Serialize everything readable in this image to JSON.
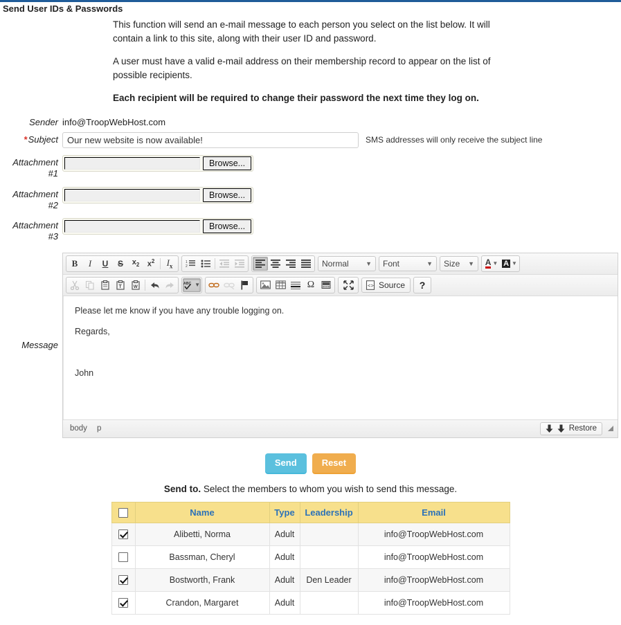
{
  "page": {
    "title": "Send User IDs & Passwords",
    "intro": [
      {
        "text": "This function will send an e-mail message to each person you select on the list below. It will contain a link to this site, along with their user ID and password.",
        "bold": false
      },
      {
        "text": "A user must have a valid e-mail address on their membership record to appear on the list of possible recipients.",
        "bold": false
      },
      {
        "text": "Each recipient will be required to change their password the next time they log on.",
        "bold": true
      }
    ]
  },
  "form": {
    "sender_label": "Sender",
    "sender_value": "info@TroopWebHost.com",
    "subject_label": "Subject",
    "subject_required_marker": "*",
    "subject_value": "Our new website is now available!",
    "subject_placeholder": "",
    "sms_note": "SMS addresses will only receive the subject line",
    "attachments": [
      {
        "label_line1": "Attachment",
        "label_line2": "#1",
        "value": "",
        "browse_label": "Browse..."
      },
      {
        "label_line1": "Attachment",
        "label_line2": "#2",
        "value": "",
        "browse_label": "Browse..."
      },
      {
        "label_line1": "Attachment",
        "label_line2": "#3",
        "value": "",
        "browse_label": "Browse..."
      }
    ],
    "message_label": "Message"
  },
  "editor": {
    "toolbar_row1": {
      "group_basic": [
        {
          "icon": "bold-icon",
          "label": "B"
        },
        {
          "icon": "italic-icon",
          "label": "I"
        },
        {
          "icon": "underline-icon",
          "label": "U"
        },
        {
          "icon": "strikethrough-icon",
          "label": "S"
        },
        {
          "icon": "subscript-icon",
          "label": "x₂"
        },
        {
          "icon": "superscript-icon",
          "label": "x²"
        },
        {
          "icon": "remove-format-icon",
          "label": "Iₓ"
        }
      ],
      "group_lists": [
        {
          "icon": "numbered-list-icon"
        },
        {
          "icon": "bulleted-list-icon"
        },
        {
          "icon": "decrease-indent-icon"
        },
        {
          "icon": "increase-indent-icon"
        }
      ],
      "group_align": [
        {
          "icon": "align-left-icon",
          "active": true
        },
        {
          "icon": "align-center-icon",
          "active": false
        },
        {
          "icon": "align-right-icon",
          "active": false
        },
        {
          "icon": "align-justify-icon",
          "active": false
        }
      ],
      "combo_format": "Normal",
      "combo_font": "Font",
      "combo_size": "Size",
      "group_color": [
        {
          "icon": "text-color-icon",
          "label": "A"
        },
        {
          "icon": "background-color-icon",
          "label": "A"
        }
      ]
    },
    "toolbar_row2": {
      "group_clipboard": [
        {
          "icon": "cut-icon",
          "disabled": true
        },
        {
          "icon": "copy-icon",
          "disabled": true
        },
        {
          "icon": "paste-icon",
          "disabled": false
        },
        {
          "icon": "paste-text-icon",
          "disabled": false
        },
        {
          "icon": "paste-word-icon",
          "disabled": false
        },
        {
          "icon": "undo-icon",
          "disabled": false
        },
        {
          "icon": "redo-icon",
          "disabled": true
        }
      ],
      "group_spell": [
        {
          "icon": "spellcheck-icon",
          "active": true
        }
      ],
      "group_link": [
        {
          "icon": "link-icon"
        },
        {
          "icon": "unlink-icon"
        },
        {
          "icon": "anchor-flag-icon"
        }
      ],
      "group_insert": [
        {
          "icon": "image-icon"
        },
        {
          "icon": "table-icon"
        },
        {
          "icon": "horizontal-rule-icon"
        },
        {
          "icon": "special-character-icon",
          "label": "Ω"
        },
        {
          "icon": "youtube-icon"
        }
      ],
      "group_maximize": [
        {
          "icon": "maximize-icon"
        }
      ],
      "source_label": "Source",
      "help_label": "?"
    },
    "body_paragraphs": [
      "Please let me know if you have any trouble logging on.",
      "Regards,",
      "",
      "John"
    ],
    "footer": {
      "element_path": [
        "body",
        "p"
      ],
      "save_icon": "save-draft-icon",
      "restore_icon": "restore-draft-icon",
      "restore_label": "Restore",
      "resize_handle": "resize-grip-icon"
    }
  },
  "actions": {
    "send_label": "Send",
    "reset_label": "Reset",
    "send_color": "#5bc0de",
    "reset_color": "#f0ad4e"
  },
  "recipients": {
    "heading_bold": "Send to.",
    "heading_rest": "Select the members to whom you wish to send this message.",
    "columns": [
      "",
      "Name",
      "Type",
      "Leadership",
      "Email"
    ],
    "header_bg": "#f7e08c",
    "header_text_color": "#2c72b8",
    "select_all_checked": false,
    "rows": [
      {
        "checked": true,
        "name": "Alibetti, Norma",
        "type": "Adult",
        "leadership": "",
        "email": "info@TroopWebHost.com"
      },
      {
        "checked": false,
        "name": "Bassman, Cheryl",
        "type": "Adult",
        "leadership": "",
        "email": "info@TroopWebHost.com"
      },
      {
        "checked": true,
        "name": "Bostworth, Frank",
        "type": "Adult",
        "leadership": "Den Leader",
        "email": "info@TroopWebHost.com"
      },
      {
        "checked": true,
        "name": "Crandon, Margaret",
        "type": "Adult",
        "leadership": "",
        "email": "info@TroopWebHost.com"
      }
    ]
  }
}
